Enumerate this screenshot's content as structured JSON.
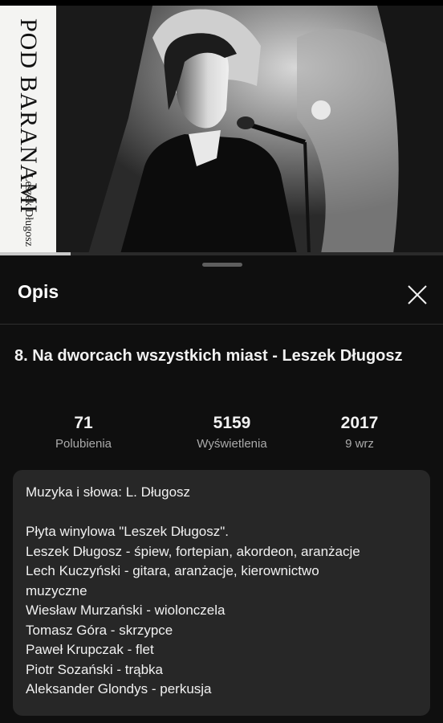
{
  "player": {
    "album_spine_title": "POD BARANAMI",
    "album_spine_author": "Leszek Długosz",
    "progress_fraction": 0.16
  },
  "sheet": {
    "title": "Opis",
    "video_title": "8. Na dworcach wszystkich miast - Leszek Długosz"
  },
  "stats": {
    "likes_value": "71",
    "likes_label": "Polubienia",
    "views_value": "5159",
    "views_label": "Wyświetlenia",
    "year_value": "2017",
    "date_label": "9 wrz"
  },
  "description": {
    "lines": [
      "Muzyka i słowa: L. Długosz",
      "",
      "Płyta winylowa \"Leszek Długosz\".",
      "Leszek Długosz - śpiew, fortepian, akordeon, aranżacje",
      "Lech Kuczyński - gitara, aranżacje, kierownictwo",
      "muzyczne",
      "Wiesław Murzański - wiolonczela",
      "Tomasz Góra - skrzypce",
      "Paweł Krupczak - flet",
      "Piotr Sozański - trąbka",
      "Aleksander Glondys - perkusja"
    ]
  }
}
